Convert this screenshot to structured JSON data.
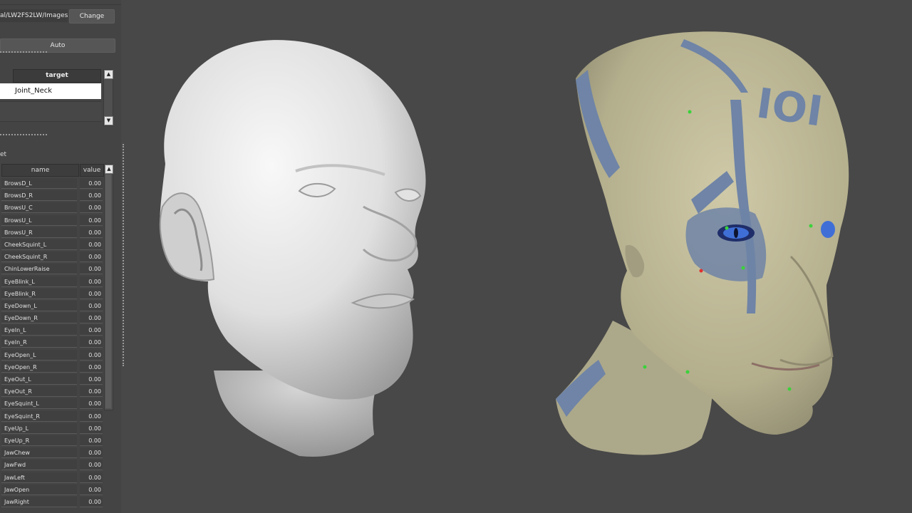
{
  "panel": {
    "path_value": "al/LW2FS2LW/Images",
    "change_label": "Change",
    "auto_label": "Auto",
    "target_table": {
      "header": "target",
      "selected_value": "Joint_Neck"
    },
    "section_label": "et",
    "morph_table": {
      "col_name": "name",
      "col_value": "value",
      "rows": [
        {
          "name": "BrowsD_L",
          "value": "0.00"
        },
        {
          "name": "BrowsD_R",
          "value": "0.00"
        },
        {
          "name": "BrowsU_C",
          "value": "0.00"
        },
        {
          "name": "BrowsU_L",
          "value": "0.00"
        },
        {
          "name": "BrowsU_R",
          "value": "0.00"
        },
        {
          "name": "CheekSquint_L",
          "value": "0.00"
        },
        {
          "name": "CheekSquint_R",
          "value": "0.00"
        },
        {
          "name": "ChinLowerRaise",
          "value": "0.00"
        },
        {
          "name": "EyeBlink_L",
          "value": "0.00"
        },
        {
          "name": "EyeBlink_R",
          "value": "0.00"
        },
        {
          "name": "EyeDown_L",
          "value": "0.00"
        },
        {
          "name": "EyeDown_R",
          "value": "0.00"
        },
        {
          "name": "EyeIn_L",
          "value": "0.00"
        },
        {
          "name": "EyeIn_R",
          "value": "0.00"
        },
        {
          "name": "EyeOpen_L",
          "value": "0.00"
        },
        {
          "name": "EyeOpen_R",
          "value": "0.00"
        },
        {
          "name": "EyeOut_L",
          "value": "0.00"
        },
        {
          "name": "EyeOut_R",
          "value": "0.00"
        },
        {
          "name": "EyeSquint_L",
          "value": "0.00"
        },
        {
          "name": "EyeSquint_R",
          "value": "0.00"
        },
        {
          "name": "EyeUp_L",
          "value": "0.00"
        },
        {
          "name": "EyeUp_R",
          "value": "0.00"
        },
        {
          "name": "JawChew",
          "value": "0.00"
        },
        {
          "name": "JawFwd",
          "value": "0.00"
        },
        {
          "name": "JawLeft",
          "value": "0.00"
        },
        {
          "name": "JawOpen",
          "value": "0.00"
        },
        {
          "name": "JawRight",
          "value": "0.00"
        }
      ]
    }
  },
  "viewport": {
    "background": "#484848",
    "skin_color": "#bcb99a",
    "tattoo_color": "#6f84a6",
    "eye_color": "#3f6fd6",
    "marker_green": "#3bd23b",
    "marker_red": "#e03030",
    "tattoo_text": "IOI"
  }
}
